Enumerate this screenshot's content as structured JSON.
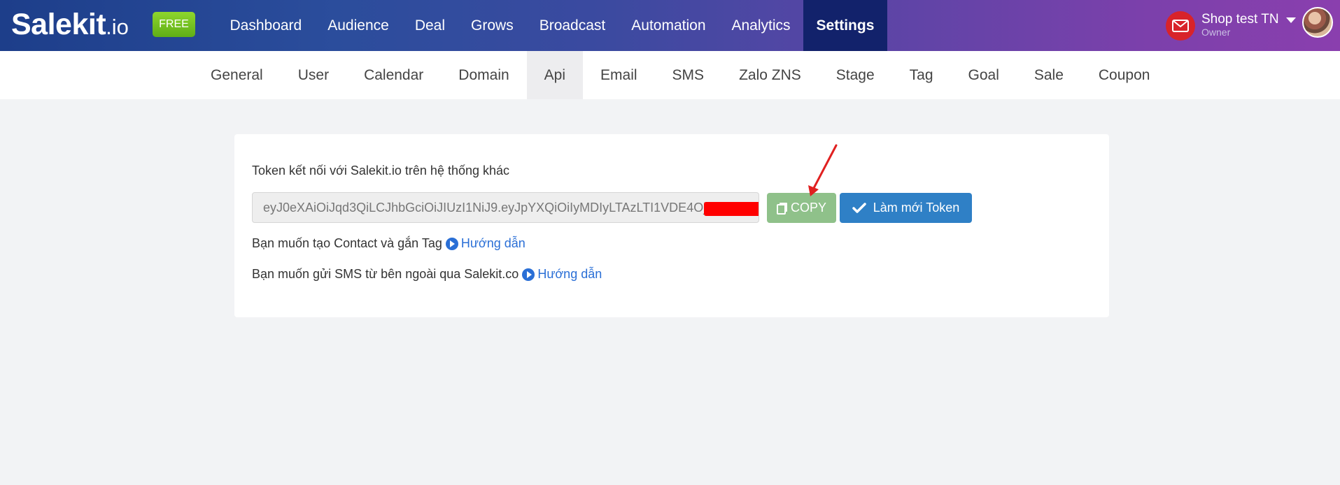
{
  "header": {
    "logo_main": "Salekit",
    "logo_suffix": ".io",
    "plan_badge": "FREE",
    "nav": [
      {
        "label": "Dashboard"
      },
      {
        "label": "Audience"
      },
      {
        "label": "Deal"
      },
      {
        "label": "Grows"
      },
      {
        "label": "Broadcast"
      },
      {
        "label": "Automation"
      },
      {
        "label": "Analytics"
      },
      {
        "label": "Settings",
        "active": true
      }
    ],
    "user": {
      "name": "Shop test TN",
      "role": "Owner"
    }
  },
  "subnav": [
    {
      "label": "General"
    },
    {
      "label": "User"
    },
    {
      "label": "Calendar"
    },
    {
      "label": "Domain"
    },
    {
      "label": "Api",
      "active": true
    },
    {
      "label": "Email"
    },
    {
      "label": "SMS"
    },
    {
      "label": "Zalo ZNS"
    },
    {
      "label": "Stage"
    },
    {
      "label": "Tag"
    },
    {
      "label": "Goal"
    },
    {
      "label": "Sale"
    },
    {
      "label": "Coupon"
    }
  ],
  "api": {
    "token_label": "Token kết nối với Salekit.io trên hệ thống khác",
    "token_value": "eyJ0eXAiOiJqd3QiLCJhbGciOiJIUzI1NiJ9.eyJpYXQiOiIyMDIyLTAzLTI1VDE4OjM",
    "copy_label": "COPY",
    "refresh_label": "Làm mới Token",
    "help1_text": "Bạn muốn tạo Contact và gắn Tag",
    "help2_text": "Bạn muốn gửi SMS từ bên ngoài qua Salekit.co",
    "guide_label": "Hướng dẫn"
  },
  "colors": {
    "nav_active": "#12226b",
    "copy_button": "#8fc18a",
    "refresh_button": "#2f80c6",
    "link": "#2a6fd6",
    "free_badge": "#7cc520",
    "annotation_arrow": "#e02020"
  }
}
